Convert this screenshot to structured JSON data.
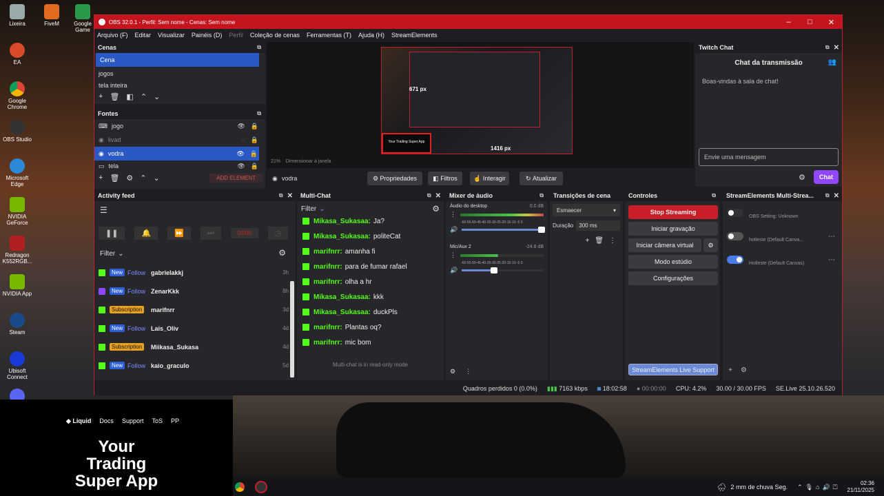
{
  "desktop": {
    "icons": [
      {
        "label": "Lixeira"
      },
      {
        "label": "FiveM"
      },
      {
        "label": "Google Game"
      },
      {
        "label": "EA"
      },
      {
        "label": "Google Chrome"
      },
      {
        "label": "OBS Studio"
      },
      {
        "label": "Microsoft Edge"
      },
      {
        "label": "NVIDIA GeForce"
      },
      {
        "label": "Redragon K552RGB..."
      },
      {
        "label": "NVIDIA App"
      },
      {
        "label": "Steam"
      },
      {
        "label": "Ubisoft Connect"
      }
    ]
  },
  "window": {
    "title": "OBS 32.0.1 - Perfil: Sem nome - Cenas: Sem nome",
    "menu": [
      "Arquivo (F)",
      "Editar",
      "Visualizar",
      "Painéis (D)",
      "Perfil",
      "Coleção de cenas",
      "Ferramentas (T)",
      "Ajuda (H)",
      "StreamElements"
    ]
  },
  "scenes": {
    "title": "Cenas",
    "items": [
      "Cena",
      "jogos",
      "tela inteira"
    ]
  },
  "sources": {
    "title": "Fontes",
    "items": [
      "jogo",
      "livad",
      "vodra",
      "tela"
    ],
    "add_label": "ADD ELEMENT"
  },
  "preview": {
    "size_h": "671 px",
    "size_w": "1416 px",
    "zoom": "21%",
    "scale_label": "Dimensionar à janela",
    "ad_text": "Your Trading Super App"
  },
  "source_toolbar": {
    "selected": "vodra",
    "properties": "Propriedades",
    "filters": "Filtros",
    "interact": "Interagir",
    "update": "Atualizar"
  },
  "twitch_chat": {
    "title": "Twitch Chat",
    "header": "Chat da transmissão",
    "welcome": "Boas-vindas à sala de chat!",
    "placeholder": "Envie uma mensagem",
    "chat_btn": "Chat"
  },
  "activity": {
    "title": "Activity feed",
    "filter": "Filter",
    "counter": "00:00",
    "rows": [
      {
        "type": "New",
        "kind": "Follow",
        "name": "gabrielakkj",
        "date": "3h",
        "platform": "kick"
      },
      {
        "type": "New",
        "kind": "Follow",
        "name": "ZenarKkk",
        "date": "8h",
        "platform": "twitch"
      },
      {
        "type": "Subscription",
        "kind": "",
        "name": "marifnrr",
        "date": "3d",
        "platform": "kick"
      },
      {
        "type": "New",
        "kind": "Follow",
        "name": "Lais_Oliv",
        "date": "4d",
        "platform": "kick"
      },
      {
        "type": "Subscription",
        "kind": "",
        "name": "Miikasa_Sukasa",
        "date": "4d",
        "platform": "kick"
      },
      {
        "type": "New",
        "kind": "Follow",
        "name": "kaio_graculo",
        "date": "5d",
        "platform": "kick"
      }
    ]
  },
  "multichat": {
    "title": "Multi-Chat",
    "filter": "Filter",
    "readonly": "Multi-chat is in read-only mode",
    "messages": [
      {
        "user": "Mikasa_Sukasaa:",
        "text": "Ja?"
      },
      {
        "user": "Mikasa_Sukasaa:",
        "text": "politeCat"
      },
      {
        "user": "marifnrr:",
        "text": "amanha fi"
      },
      {
        "user": "marifnrr:",
        "text": "para de fumar rafael"
      },
      {
        "user": "marifnrr:",
        "text": "olha a hr"
      },
      {
        "user": "Mikasa_Sukasaa:",
        "text": "kkk"
      },
      {
        "user": "Mikasa_Sukasaa:",
        "text": "duckPls"
      },
      {
        "user": "marifnrr:",
        "text": "Plantas oq?"
      },
      {
        "user": "marifnrr:",
        "text": "mic bom"
      }
    ]
  },
  "mixer": {
    "title": "Mixer de áudio",
    "ch1_name": "Áudio do desktop",
    "ch1_db": "0.0 dB",
    "ch2_name": "Mic/Aux 2",
    "ch2_db": "-24.8 dB",
    "scale": "-60-55-50-45-40-35-30-25-20-15-10 -5 0"
  },
  "transitions": {
    "title": "Transições de cena",
    "type": "Esmaecer",
    "duration_label": "Duração",
    "duration": "300 ms"
  },
  "controls": {
    "title": "Controles",
    "stop": "Stop Streaming",
    "record": "Iniciar gravação",
    "vcam": "Iniciar câmera virtual",
    "studio": "Modo estúdio",
    "settings": "Configurações",
    "support": "StreamElements Live Support"
  },
  "se_multistream": {
    "title": "StreamElements Multi-Strea...",
    "items": [
      {
        "label": "OBS Setting: Unknown",
        "enabled": false
      },
      {
        "label": "hotleste (Default Canva...",
        "enabled": false
      },
      {
        "label": "Hotleste (Default Canvas)",
        "enabled": true
      }
    ]
  },
  "statusbar": {
    "dropped": "Quadros perdidos 0 (0.0%)",
    "kbps": "7163 kbps",
    "live_time": "18:02:58",
    "rec_time": "00:00:00",
    "cpu": "CPU: 4.2%",
    "fps": "30.00 / 30.00 FPS",
    "version": "SE.Live 25.10.26.520"
  },
  "promo": {
    "brand": "Liquid",
    "links": [
      "Docs",
      "Support",
      "ToS",
      "PP"
    ],
    "headline": [
      "Your",
      "Trading",
      "Super App"
    ]
  },
  "taskbar": {
    "weather": "2 mm de chuva Seg.",
    "time": "02:36",
    "date": "21/11/2025"
  }
}
